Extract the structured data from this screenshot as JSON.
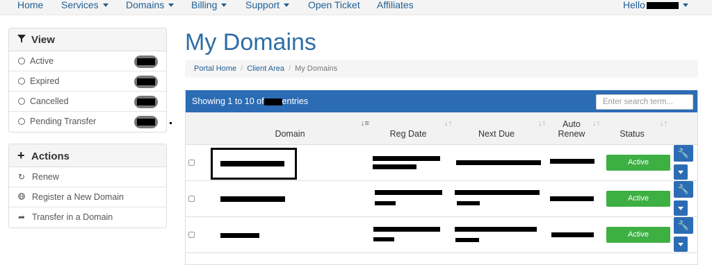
{
  "nav": {
    "home": "Home",
    "services": "Services",
    "domains": "Domains",
    "billing": "Billing",
    "support": "Support",
    "open_ticket": "Open Ticket",
    "affiliates": "Affiliates",
    "hello": "Hello"
  },
  "view_panel": {
    "title": "View",
    "icon": "filter-icon",
    "items": [
      {
        "label": "Active"
      },
      {
        "label": "Expired"
      },
      {
        "label": "Cancelled"
      },
      {
        "label": "Pending Transfer"
      }
    ]
  },
  "actions_panel": {
    "title": "Actions",
    "icon": "plus-icon",
    "items": [
      {
        "label": "Renew",
        "icon": "refresh-icon"
      },
      {
        "label": "Register a New Domain",
        "icon": "globe-icon"
      },
      {
        "label": "Transfer in a Domain",
        "icon": "share-arrow-icon"
      }
    ]
  },
  "page": {
    "title": "My Domains",
    "breadcrumb": [
      "Portal Home",
      "Client Area",
      "My Domains"
    ]
  },
  "table": {
    "showing_prefix": "Showing 1 to 10 of",
    "showing_suffix": "entries",
    "search_placeholder": "Enter search term...",
    "columns": {
      "domain": "Domain",
      "reg_date": "Reg Date",
      "next_due": "Next Due",
      "auto_renew_1": "Auto",
      "auto_renew_2": "Renew",
      "status": "Status"
    },
    "rows": [
      {
        "status": "Active"
      },
      {
        "status": "Active"
      },
      {
        "status": "Active"
      }
    ]
  },
  "colors": {
    "brand_blue": "#2c6cb5",
    "status_green": "#3eaf43"
  }
}
